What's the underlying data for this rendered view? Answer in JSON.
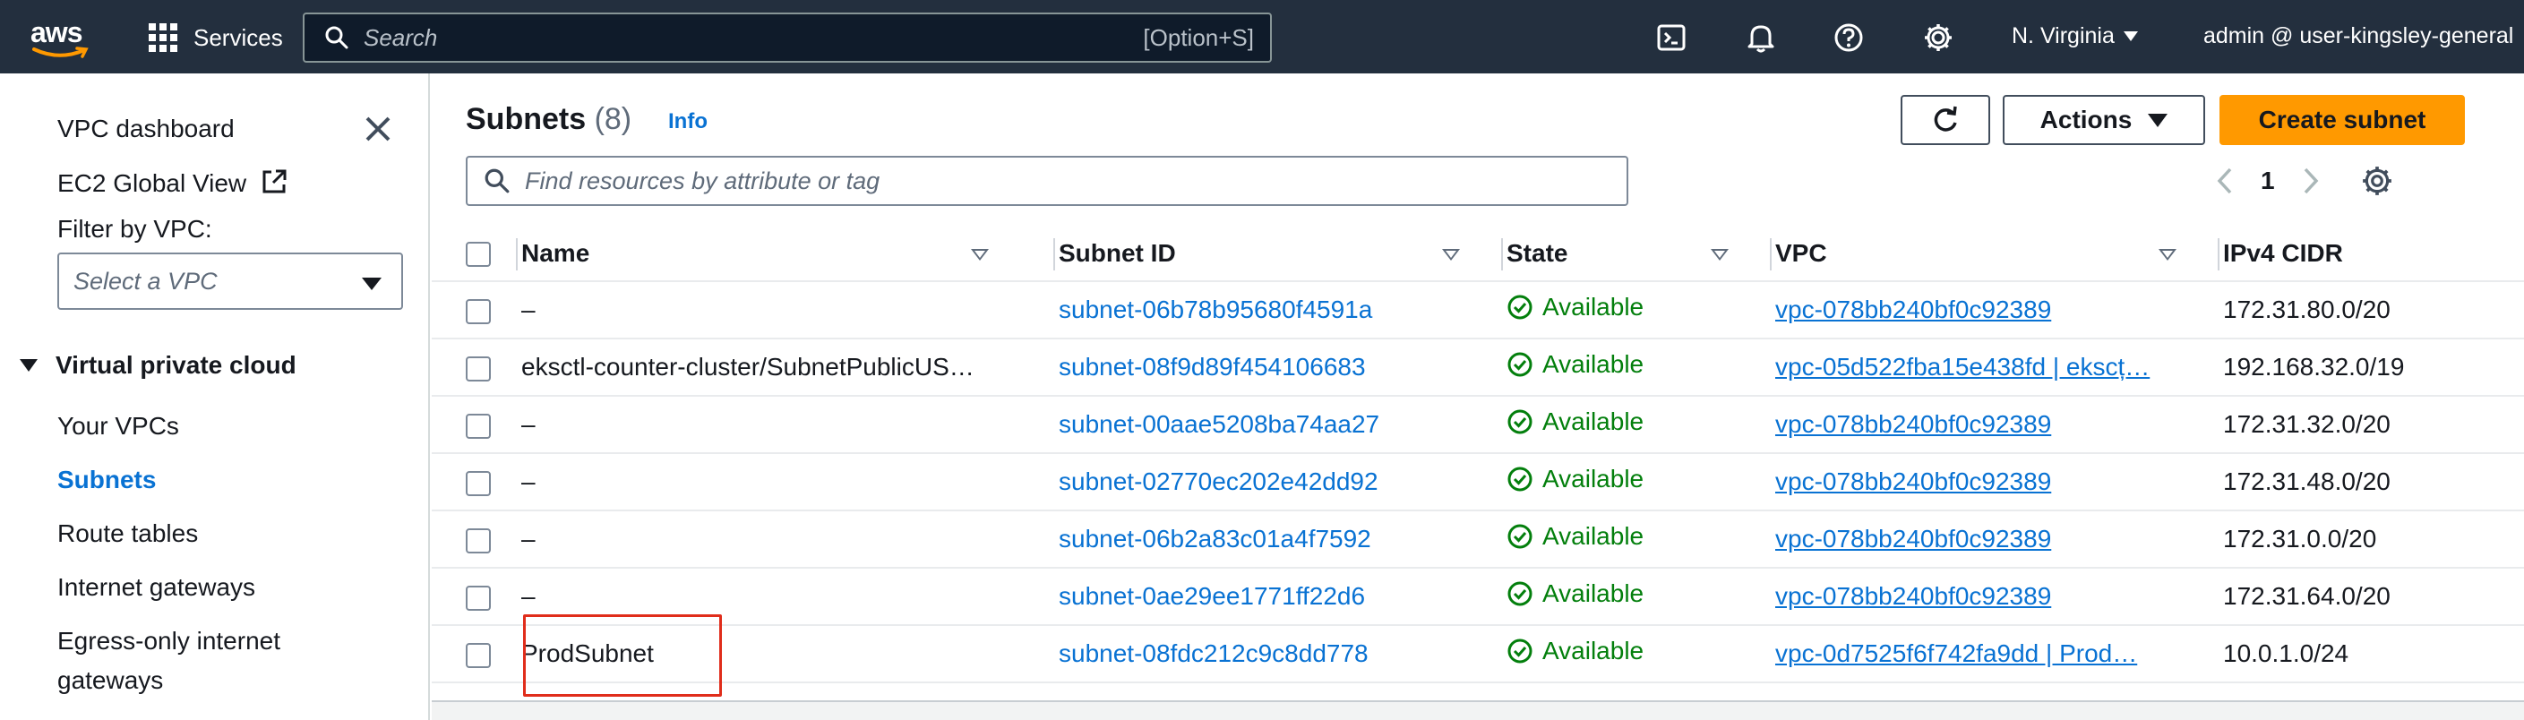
{
  "topbar": {
    "logo_text": "aws",
    "services_label": "Services",
    "search_placeholder": "Search",
    "search_shortcut": "[Option+S]",
    "region": "N. Virginia",
    "account": "admin @ user-kingsley-general"
  },
  "sidebar": {
    "links": [
      "VPC dashboard",
      "EC2 Global View"
    ],
    "filter_label": "Filter by VPC:",
    "vpc_select_placeholder": "Select a VPC",
    "section_title": "Virtual private cloud",
    "nav_items": [
      {
        "label": "Your VPCs",
        "active": false
      },
      {
        "label": "Subnets",
        "active": true
      },
      {
        "label": "Route tables",
        "active": false
      },
      {
        "label": "Internet gateways",
        "active": false
      },
      {
        "label": "Egress-only internet",
        "active": false
      },
      {
        "label": "gateways",
        "active": false
      }
    ]
  },
  "main": {
    "title": "Subnets",
    "count": "(8)",
    "info_label": "Info",
    "actions_label": "Actions",
    "create_label": "Create subnet",
    "filter_placeholder": "Find resources by attribute or tag",
    "page_number": "1",
    "columns": [
      "Name",
      "Subnet ID",
      "State",
      "VPC",
      "IPv4 CIDR"
    ],
    "rows": [
      {
        "name": "–",
        "subnet_id": "subnet-06b78b95680f4591a",
        "state": "Available",
        "vpc": "vpc-078bb240bf0c92389",
        "cidr": "172.31.80.0/20"
      },
      {
        "name": "eksctl-counter-cluster/SubnetPublicUS…",
        "subnet_id": "subnet-08f9d89f454106683",
        "state": "Available",
        "vpc": "vpc-05d522fba15e438fd | ekscț…",
        "cidr": "192.168.32.0/19"
      },
      {
        "name": "–",
        "subnet_id": "subnet-00aae5208ba74aa27",
        "state": "Available",
        "vpc": "vpc-078bb240bf0c92389",
        "cidr": "172.31.32.0/20"
      },
      {
        "name": "–",
        "subnet_id": "subnet-02770ec202e42dd92",
        "state": "Available",
        "vpc": "vpc-078bb240bf0c92389",
        "cidr": "172.31.48.0/20"
      },
      {
        "name": "–",
        "subnet_id": "subnet-06b2a83c01a4f7592",
        "state": "Available",
        "vpc": "vpc-078bb240bf0c92389",
        "cidr": "172.31.0.0/20"
      },
      {
        "name": "–",
        "subnet_id": "subnet-0ae29ee1771ff22d6",
        "state": "Available",
        "vpc": "vpc-078bb240bf0c92389",
        "cidr": "172.31.64.0/20"
      },
      {
        "name": "ProdSubnet",
        "subnet_id": "subnet-08fdc212c9c8dd778",
        "state": "Available",
        "vpc": "vpc-0d7525f6f742fa9dd | Prod…",
        "cidr": "10.0.1.0/24"
      }
    ]
  },
  "colors": {
    "topbar_bg": "#232f3e",
    "link": "#0972d3",
    "primary_button": "#ff9900",
    "status_available": "#037f0c",
    "highlight": "#e02d1b"
  }
}
